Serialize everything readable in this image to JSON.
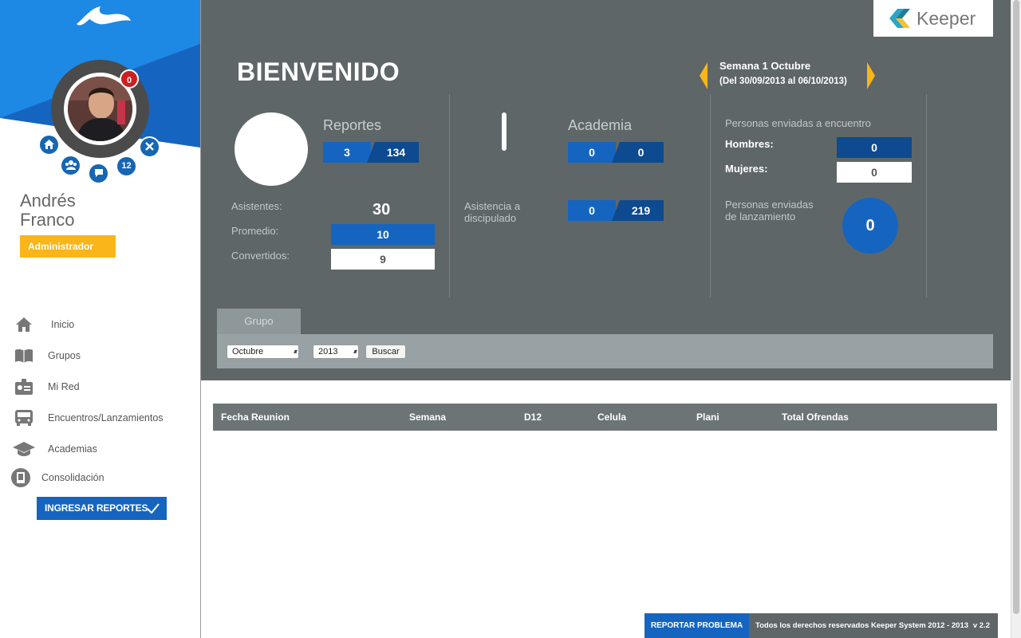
{
  "colors": {
    "primary_blue": "#1565c0",
    "dark_blue": "#0d4a8f",
    "panel_gray": "#5f6668",
    "accent_yellow": "#f9b51a",
    "alert_red": "#cc1f1f"
  },
  "sidebar": {
    "notification_count": "0",
    "network_count": "12",
    "user_first_name": "Andrés",
    "user_last_name": "Franco",
    "role": "Administrador",
    "nav": [
      {
        "label": "Inicio",
        "icon": "home-icon"
      },
      {
        "label": "Grupos",
        "icon": "book-icon"
      },
      {
        "label": "Mi Red",
        "icon": "id-card-icon"
      },
      {
        "label": "Encuentros/Lanzamientos",
        "icon": "bus-icon"
      },
      {
        "label": "Academias",
        "icon": "graduation-cap-icon"
      },
      {
        "label": "Consolidación",
        "icon": "tablet-icon"
      }
    ],
    "report_button": "INGRESAR REPORTES"
  },
  "header": {
    "brand": "Keeper",
    "welcome": "BIENVENIDO",
    "week_title": "Semana 1 Octubre",
    "week_range": "(Del 30/09/2013 al 06/10/2013)"
  },
  "stats": {
    "reportes": {
      "title": "Reportes",
      "left": "3",
      "right": "134"
    },
    "asistentes_label": "Asistentes:",
    "asistentes": "30",
    "promedio_label": "Promedio:",
    "promedio": "10",
    "convertidos_label": "Convertidos:",
    "convertidos": "9",
    "academia": {
      "title": "Academia",
      "left": "0",
      "right": "0"
    },
    "discipulado": {
      "label_line1": "Asistencia a",
      "label_line2": "discipulado",
      "left": "0",
      "right": "219"
    },
    "encuentro_title": "Personas enviadas a encuentro",
    "hombres_label": "Hombres:",
    "hombres": "0",
    "mujeres_label": "Mujeres:",
    "mujeres": "0",
    "lanzamiento_line1": "Personas enviadas",
    "lanzamiento_line2": "de lanzamiento",
    "lanzamiento": "0"
  },
  "filters": {
    "tab": "Grupo",
    "month": "Octubre",
    "year": "2013",
    "search_button": "Buscar"
  },
  "table": {
    "headers": [
      "Fecha Reunion",
      "Semana",
      "D12",
      "Celula",
      "Plani",
      "Total Ofrendas"
    ]
  },
  "footer": {
    "report_problem": "REPORTAR PROBLEMA",
    "copyright": "Todos los derechos reservados Keeper System 2012 - 2013",
    "version": "v 2.2"
  }
}
